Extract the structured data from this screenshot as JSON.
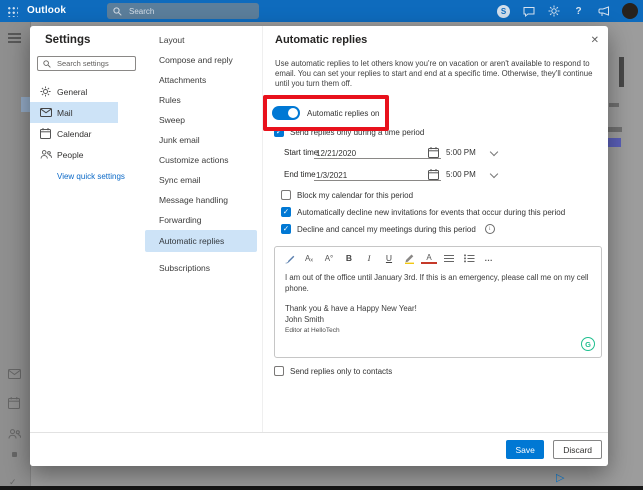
{
  "topbar": {
    "app_name": "Outlook",
    "search_placeholder": "Search",
    "right_icons": [
      "skype-icon",
      "chat-icon",
      "settings-gear-icon",
      "help-icon",
      "whats-new-icon",
      "account-avatar"
    ]
  },
  "left_rail": {
    "icons": [
      "menu-icon",
      "mail-icon",
      "calendar-icon",
      "people-icon",
      "tasks-icon",
      "check-icon"
    ]
  },
  "settings_nav": {
    "title": "Settings",
    "search_placeholder": "Search settings",
    "items": [
      {
        "label": "General",
        "icon": "gear-icon",
        "selected": false
      },
      {
        "label": "Mail",
        "icon": "envelope-icon",
        "selected": true
      },
      {
        "label": "Calendar",
        "icon": "calendar-icon",
        "selected": false
      },
      {
        "label": "People",
        "icon": "people-icon",
        "selected": false
      }
    ],
    "quick_settings_link": "View quick settings"
  },
  "categories": {
    "items": [
      "Layout",
      "Compose and reply",
      "Attachments",
      "Rules",
      "Sweep",
      "Junk email",
      "Customize actions",
      "Sync email",
      "Message handling",
      "Forwarding",
      "Automatic replies",
      "Subscriptions"
    ],
    "selected": "Automatic replies"
  },
  "panel": {
    "title": "Automatic replies",
    "description": "Use automatic replies to let others know you're on vacation or aren't available to respond to email. You can set your replies to start and end at a specific time. Otherwise, they'll continue until you turn them off.",
    "toggle": {
      "label": "Automatic replies on",
      "state": "on"
    },
    "time_period": {
      "checkbox_label": "Send replies only during a time period",
      "checked": true,
      "start": {
        "label": "Start time",
        "date": "12/21/2020",
        "time": "5:00 PM"
      },
      "end": {
        "label": "End time",
        "date": "1/3/2021",
        "time": "5:00 PM"
      }
    },
    "options": [
      {
        "label": "Block my calendar for this period",
        "checked": false
      },
      {
        "label": "Automatically decline new invitations for events that occur during this period",
        "checked": true
      },
      {
        "label": "Decline and cancel my meetings during this period",
        "checked": true,
        "has_info_icon": true
      }
    ],
    "editor": {
      "toolbar_icons": [
        "format-painter",
        "clear-formatting",
        "font-size",
        "bold",
        "italic",
        "underline",
        "highlight",
        "font-color",
        "align",
        "bullet-list",
        "more-options"
      ],
      "message": {
        "paragraph": "I am out of the office until January 3rd. If this is an emergency, please call me on my cell phone.",
        "closing": "Thank you & have a Happy New Year!",
        "signature_name": "John Smith",
        "signature_title": "Editor at HelloTech"
      },
      "grammarly_badge": "G"
    },
    "contacts_checkbox": {
      "label": "Send replies only to contacts",
      "checked": false
    },
    "footer": {
      "save_label": "Save",
      "discard_label": "Discard"
    }
  },
  "annotation": {
    "type": "red-highlight-box",
    "around": "Automatic replies on toggle",
    "color": "#e8111c"
  },
  "colors": {
    "accent": "#0078d4",
    "topbar": "#0e6bbd",
    "selected_item_bg": "#cde3f7",
    "overlay": "#9c9c9c"
  }
}
